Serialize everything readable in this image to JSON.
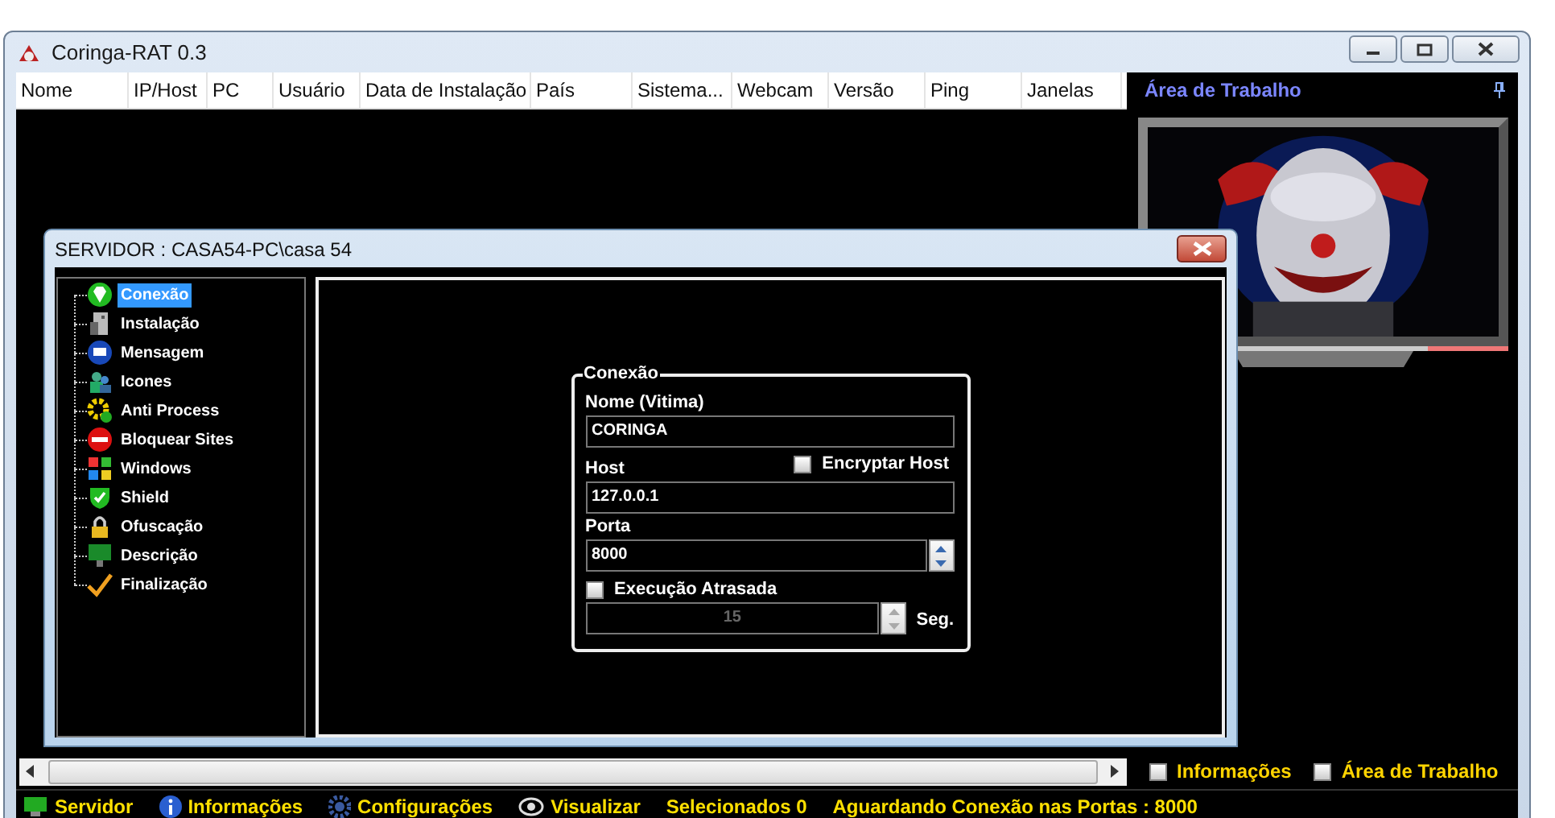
{
  "window": {
    "title": "Coringa-RAT 0.3"
  },
  "columns": [
    "Nome",
    "IP/Host",
    "PC",
    "Usuário",
    "Data de Instalação",
    "País",
    "Sistema...",
    "Webcam",
    "Versão",
    "Ping",
    "Janelas"
  ],
  "desktop_panel": {
    "title": "Área de Trabalho"
  },
  "dialog": {
    "title": "SERVIDOR : CASA54-PC\\casa 54",
    "tree": [
      {
        "label": "Conexão",
        "kind": "connect",
        "selected": true
      },
      {
        "label": "Instalação",
        "kind": "install",
        "selected": false
      },
      {
        "label": "Mensagem",
        "kind": "message",
        "selected": false
      },
      {
        "label": "Icones",
        "kind": "people",
        "selected": false
      },
      {
        "label": "Anti Process",
        "kind": "gear",
        "selected": false
      },
      {
        "label": "Bloquear Sites",
        "kind": "block",
        "selected": false
      },
      {
        "label": "Windows",
        "kind": "windows",
        "selected": false
      },
      {
        "label": "Shield",
        "kind": "shield",
        "selected": false
      },
      {
        "label": "Ofuscação",
        "kind": "lock",
        "selected": false
      },
      {
        "label": "Descrição",
        "kind": "monitor",
        "selected": false
      },
      {
        "label": "Finalização",
        "kind": "check",
        "selected": false
      }
    ],
    "group": {
      "title": "Conexão",
      "name_label": "Nome (Vitima)",
      "name_value": "CORINGA",
      "encrypt": {
        "label": "Encryptar Host",
        "checked": false
      },
      "host_label": "Host",
      "host_value": "127.0.0.1",
      "port_label": "Porta",
      "port_value": "8000",
      "delay": {
        "label": "Execução Atrasada",
        "checked": false
      },
      "delay_value": "15",
      "delay_unit": "Seg."
    }
  },
  "bottom_checks": [
    {
      "label": "Informações",
      "checked": false
    },
    {
      "label": "Área de Trabalho",
      "checked": false
    }
  ],
  "status_bar": {
    "items": [
      {
        "label": "Servidor",
        "kind": "server"
      },
      {
        "label": "Informações",
        "kind": "info"
      },
      {
        "label": "Configurações",
        "kind": "gear"
      },
      {
        "label": "Visualizar",
        "kind": "eye"
      }
    ],
    "selected": "Selecionados 0",
    "waiting": "Aguardando Conexão nas Portas : 8000"
  }
}
